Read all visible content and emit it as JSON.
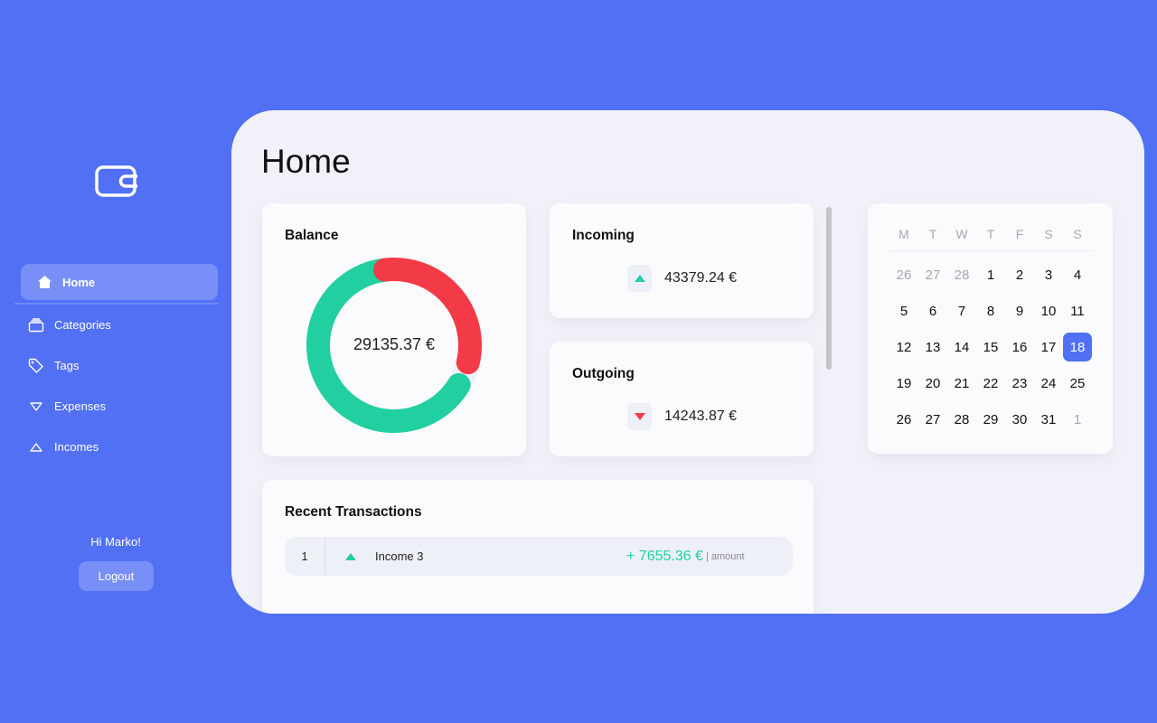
{
  "sidebar": {
    "logo_icon": "wallet-icon",
    "items": [
      {
        "label": "Home",
        "icon": "home-icon",
        "active": true
      },
      {
        "label": "Categories",
        "icon": "categories-icon"
      },
      {
        "label": "Tags",
        "icon": "tag-icon"
      },
      {
        "label": "Expenses",
        "icon": "triangle-down-icon"
      },
      {
        "label": "Incomes",
        "icon": "triangle-up-icon"
      }
    ],
    "greeting": "Hi Marko!",
    "logout_label": "Logout"
  },
  "main": {
    "title": "Home",
    "balance": {
      "title": "Balance",
      "value": "29135.37 €",
      "incoming_share": 0.7528,
      "colors": {
        "incoming": "#22cfa0",
        "outgoing": "#f23b46",
        "track": "#eeeff7"
      }
    },
    "incoming": {
      "title": "Incoming",
      "amount": "43379.24 €",
      "icon": "triangle-up-icon"
    },
    "outgoing": {
      "title": "Outgoing",
      "amount": "14243.87 €",
      "icon": "triangle-down-icon"
    },
    "recent": {
      "title": "Recent Transactions",
      "rows": [
        {
          "index": "1",
          "name": "Income 3",
          "amount": "+ 7655.36 €",
          "amount_label": "| amount",
          "type": "income"
        }
      ]
    },
    "calendar": {
      "weekdays": [
        "M",
        "T",
        "W",
        "T",
        "F",
        "S",
        "S"
      ],
      "days": [
        {
          "d": "26",
          "muted": true
        },
        {
          "d": "27",
          "muted": true
        },
        {
          "d": "28",
          "muted": true
        },
        {
          "d": "1"
        },
        {
          "d": "2"
        },
        {
          "d": "3"
        },
        {
          "d": "4"
        },
        {
          "d": "5"
        },
        {
          "d": "6"
        },
        {
          "d": "7"
        },
        {
          "d": "8"
        },
        {
          "d": "9"
        },
        {
          "d": "10"
        },
        {
          "d": "11"
        },
        {
          "d": "12"
        },
        {
          "d": "13"
        },
        {
          "d": "14"
        },
        {
          "d": "15"
        },
        {
          "d": "16"
        },
        {
          "d": "17"
        },
        {
          "d": "18",
          "today": true
        },
        {
          "d": "19"
        },
        {
          "d": "20"
        },
        {
          "d": "21"
        },
        {
          "d": "22"
        },
        {
          "d": "23"
        },
        {
          "d": "24"
        },
        {
          "d": "25"
        },
        {
          "d": "26"
        },
        {
          "d": "27"
        },
        {
          "d": "28"
        },
        {
          "d": "29"
        },
        {
          "d": "30"
        },
        {
          "d": "31"
        },
        {
          "d": "1",
          "muted": true
        }
      ]
    }
  },
  "colors": {
    "background": "#5170f4",
    "accent": "#5170f4",
    "income": "#22cfa0",
    "expense": "#f23b46"
  }
}
